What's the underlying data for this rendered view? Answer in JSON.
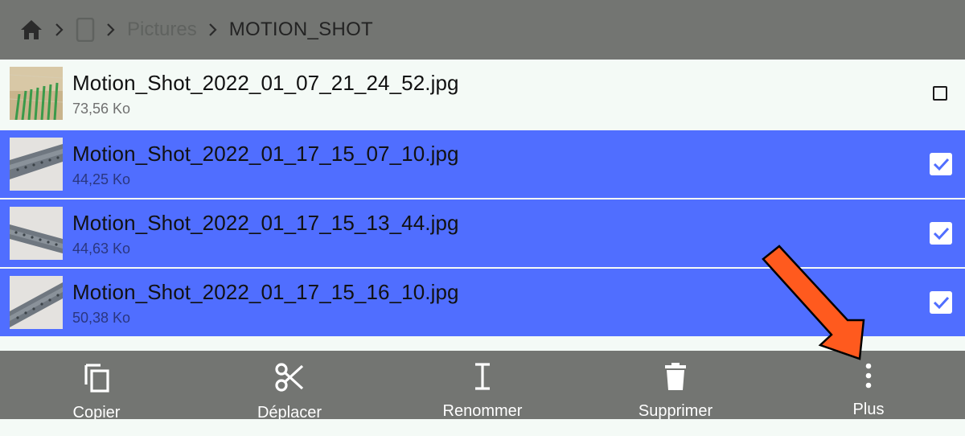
{
  "breadcrumb": {
    "home_icon": "home-icon",
    "device_icon": "phone-icon",
    "parent": "Pictures",
    "current": "MOTION_SHOT"
  },
  "files": [
    {
      "name": "Motion_Shot_2022_01_07_21_24_52.jpg",
      "size": "73,56 Ko",
      "selected": false
    },
    {
      "name": "Motion_Shot_2022_01_17_15_07_10.jpg",
      "size": "44,25 Ko",
      "selected": true
    },
    {
      "name": "Motion_Shot_2022_01_17_15_13_44.jpg",
      "size": "44,63 Ko",
      "selected": true
    },
    {
      "name": "Motion_Shot_2022_01_17_15_16_10.jpg",
      "size": "50,38 Ko",
      "selected": true
    }
  ],
  "toolbar": {
    "copy_label": "Copier",
    "move_label": "Déplacer",
    "rename_label": "Renommer",
    "delete_label": "Supprimer",
    "more_label": "Plus"
  },
  "colors": {
    "bar": "#737572",
    "selected_row": "#506eff",
    "background": "#f4faf6",
    "annotation_arrow": "#ff5a1e"
  }
}
